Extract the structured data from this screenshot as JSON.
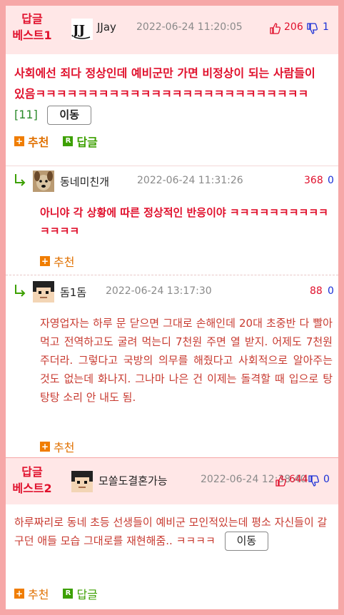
{
  "best1": {
    "tag_line1": "답글",
    "tag_line2": "베스트1",
    "author": "JJay",
    "date": "2022-06-24 11:20:05",
    "up": "206",
    "down": "1",
    "text": "사회에선 죄다 정상인데 예비군만 가면 비정상이 되는 사람들이 있음ㅋㅋㅋㅋㅋㅋㅋㅋㅋㅋㅋㅋㅋㅋㅋㅋㅋㅋㅋㅋㅋㅋㅋㅋㅋㅋ",
    "comment_count": "[11]",
    "move_label": "이동",
    "recommend_label": "추천",
    "reply_label": "답글"
  },
  "replies": [
    {
      "author": "동네미친개",
      "date": "2022-06-24 11:31:26",
      "up": "368",
      "down": "0",
      "text": "아니야 각 상황에 따른 정상적인 반응이야 ㅋㅋㅋㅋㅋㅋㅋㅋㅋㅋㅋㅋㅋㅋ",
      "recommend_label": "추천"
    },
    {
      "author": "돔1돔",
      "date": "2022-06-24 13:17:30",
      "up": "88",
      "down": "0",
      "text": "자영업자는 하루 문 닫으면 그대로 손해인데 20대 초중반 다 빨아먹고 전역하고도 굴려 먹는디 7천원 주면 열 받지. 어제도 7천원 주더라. 그렇다고 국방의 의무를 해줬다고 사회적으로 알아주는 것도 없는데 화나지. 그나마 나은 건 이제는 돌격할 때 입으로 탕탕탕 소리 안 내도 됨.",
      "recommend_label": "추천"
    }
  ],
  "best2": {
    "tag_line1": "답글",
    "tag_line2": "베스트2",
    "author": "모쏠도결혼가능",
    "date": "2022-06-24 12:38:40",
    "up": "644",
    "down": "0",
    "text": "하루짜리로 동네 초등 선생들이 예비군 모인적있는데 평소 자신들이 갈구던 애들 모습 그대로를 재현해줌.. ㅋㅋㅋㅋ",
    "move_label": "이동",
    "recommend_label": "추천",
    "reply_label": "답글"
  },
  "colors": {
    "frame": "#f6a7a7",
    "header_bg": "#ffe7e7",
    "accent_red": "#e0102c",
    "down_blue": "#1a2fd6",
    "recommend_orange": "#f07d00",
    "reply_green": "#3ca000"
  },
  "icons": [
    "thumbs-up-icon",
    "thumbs-down-icon",
    "reply-arrow-icon",
    "plus-icon",
    "r-icon"
  ]
}
